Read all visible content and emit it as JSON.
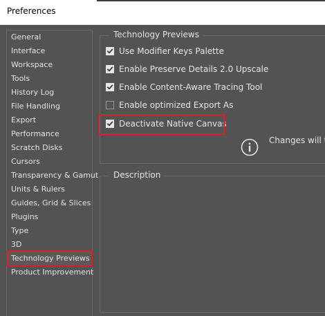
{
  "window": {
    "title": "Preferences"
  },
  "sidebar": {
    "items": [
      {
        "label": "General"
      },
      {
        "label": "Interface"
      },
      {
        "label": "Workspace"
      },
      {
        "label": "Tools"
      },
      {
        "label": "History Log"
      },
      {
        "label": "File Handling"
      },
      {
        "label": "Export"
      },
      {
        "label": "Performance"
      },
      {
        "label": "Scratch Disks"
      },
      {
        "label": "Cursors"
      },
      {
        "label": "Transparency & Gamut"
      },
      {
        "label": "Units & Rulers"
      },
      {
        "label": "Guides, Grid & Slices"
      },
      {
        "label": "Plugins"
      },
      {
        "label": "Type"
      },
      {
        "label": "3D"
      },
      {
        "label": "Technology Previews"
      },
      {
        "label": "Product Improvement"
      }
    ],
    "selected": "Technology Previews"
  },
  "tech_previews": {
    "heading": "Technology Previews",
    "options": [
      {
        "label": "Use Modifier Keys Palette",
        "checked": true
      },
      {
        "label": "Enable Preserve Details 2.0 Upscale",
        "checked": true
      },
      {
        "label": "Enable Content-Aware Tracing Tool",
        "checked": true
      },
      {
        "label": "Enable optimized Export As",
        "checked": false
      },
      {
        "label": "Deactivate Native Canvas",
        "checked": true
      }
    ],
    "info_text": "Changes will ta",
    "info_icon": "info-icon"
  },
  "description": {
    "heading": "Description"
  },
  "colors": {
    "highlight": "#d1232a",
    "background": "#535353",
    "text": "#e4e4e4"
  }
}
